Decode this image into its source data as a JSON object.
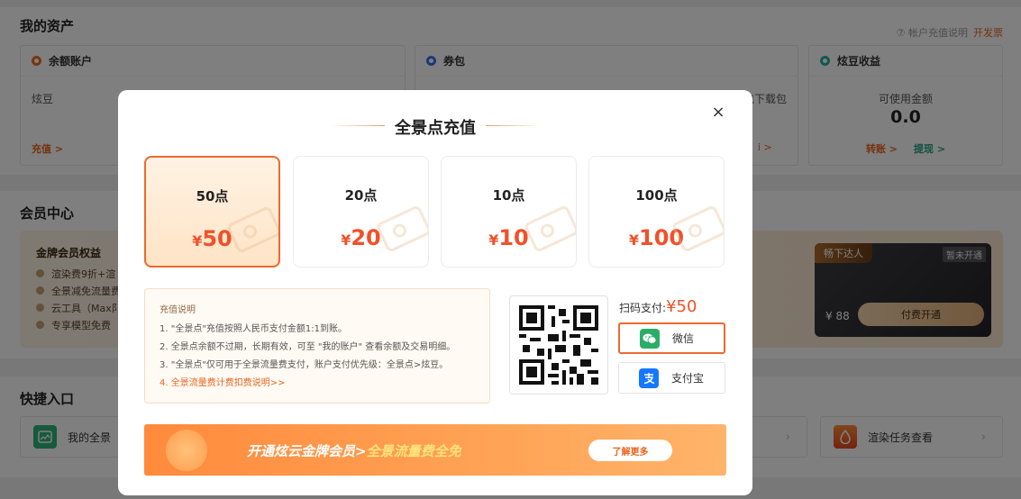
{
  "page": {
    "assets": {
      "title": "我的资产",
      "help_link": "⑦ 帐户充值说明",
      "invoice_link": "开发票",
      "balance": {
        "title": "余额账户",
        "label": "炫豆",
        "link": "充值 >"
      },
      "coupons": {
        "title": "券包",
        "peek_text": "包下载包",
        "peek_link": "i >"
      },
      "earnings": {
        "title": "炫豆收益",
        "label": "可使用金额",
        "value": "0.0",
        "transfer": "转账 >",
        "withdraw": "提现 >"
      }
    },
    "member": {
      "title": "会员中心",
      "gold_title": "金牌会员权益",
      "benefits": [
        "渲染费9折+渲",
        "全景减免流量费",
        "云工具（Max阝",
        "专享模型免费"
      ],
      "vip_card": {
        "tag": "畅下达人",
        "status": "暂未开通",
        "price": "¥ 88",
        "button": "付费开通"
      }
    },
    "quick": {
      "title": "快捷入口",
      "items": [
        "我的全景",
        "",
        "渲染任务查看"
      ],
      "chevron": "›"
    }
  },
  "modal": {
    "title": "全景点充值",
    "close": "×",
    "packages": [
      {
        "points": "50点",
        "currency": "¥",
        "amount": "50",
        "selected": true
      },
      {
        "points": "20点",
        "currency": "¥",
        "amount": "20",
        "selected": false
      },
      {
        "points": "10点",
        "currency": "¥",
        "amount": "10",
        "selected": false
      },
      {
        "points": "100点",
        "currency": "¥",
        "amount": "100",
        "selected": false
      }
    ],
    "notes": {
      "title": "充值说明",
      "lines": [
        "1. \"全景点\"充值按照人民币支付金额1:1到账。",
        "2. 全景点余额不过期，长期有效，可至 \"我的账户\" 查看余额及交易明细。",
        "3. \"全景点\"仅可用于全景流量费支付，账户支付优先级：全景点>炫豆。"
      ],
      "link": "4. 全景流量费计费扣费说明>>"
    },
    "payment": {
      "scan_label": "扫码支付:",
      "currency": "¥",
      "amount": "50",
      "options": [
        {
          "label": "微信",
          "selected": true,
          "color": "#2aae67"
        },
        {
          "label": "支付宝",
          "selected": false,
          "color": "#1677ff"
        }
      ]
    },
    "banner": {
      "text_main": "开通炫云金牌会员>",
      "text_highlight": "全景流量费全免",
      "button": "了解更多"
    }
  },
  "colors": {
    "accent": "#ec6a2c",
    "price": "#f0512a",
    "wechat": "#2aae67",
    "alipay": "#1677ff"
  }
}
